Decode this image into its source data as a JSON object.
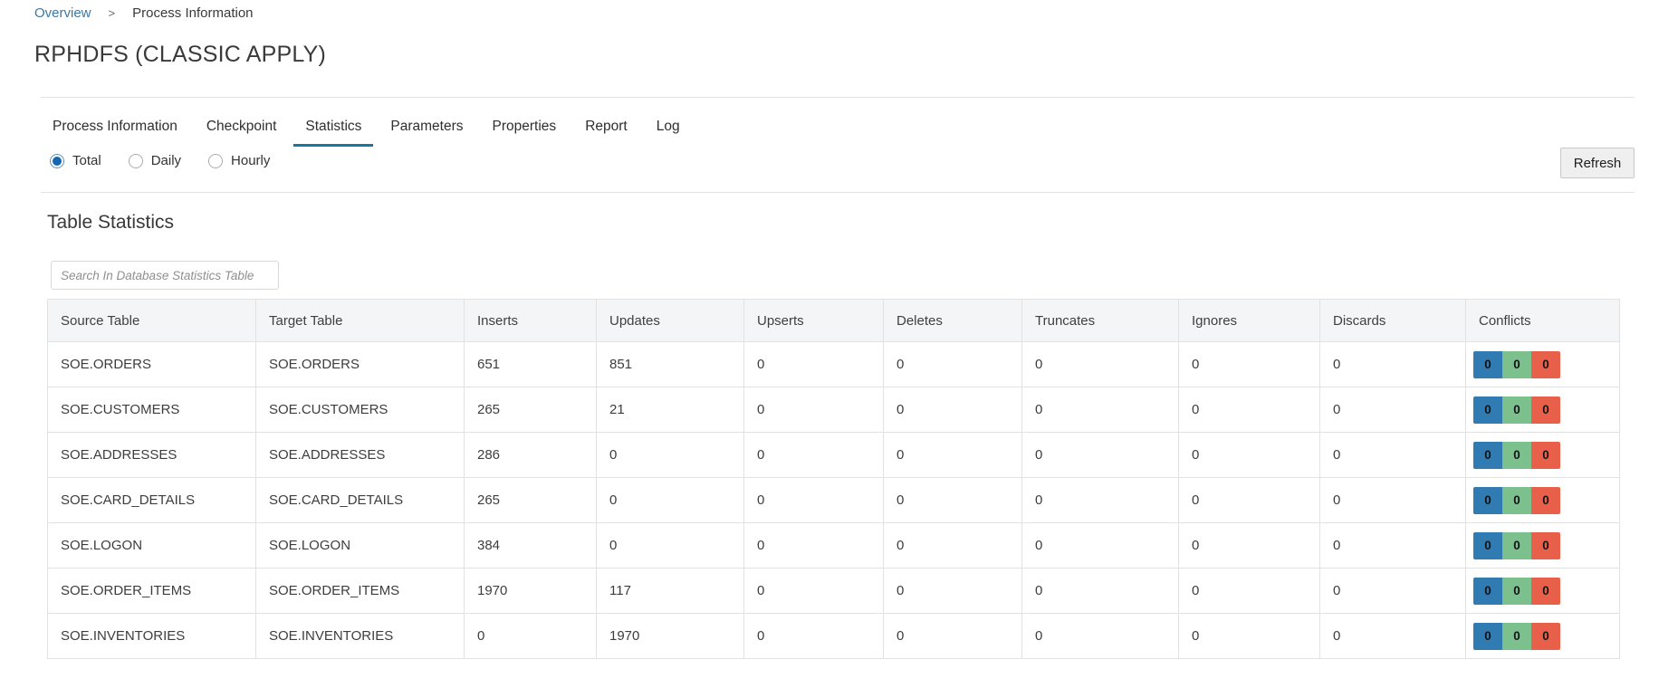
{
  "breadcrumb": {
    "overview": "Overview",
    "separator": ">",
    "current": "Process Information"
  },
  "header": {
    "title": "RPHDFS (CLASSIC APPLY)"
  },
  "tabs": {
    "items": [
      {
        "label": "Process Information",
        "active": false
      },
      {
        "label": "Checkpoint",
        "active": false
      },
      {
        "label": "Statistics",
        "active": true
      },
      {
        "label": "Parameters",
        "active": false
      },
      {
        "label": "Properties",
        "active": false
      },
      {
        "label": "Report",
        "active": false
      },
      {
        "label": "Log",
        "active": false
      }
    ]
  },
  "filters": {
    "options": [
      {
        "label": "Total",
        "selected": true
      },
      {
        "label": "Daily",
        "selected": false
      },
      {
        "label": "Hourly",
        "selected": false
      }
    ]
  },
  "toolbar": {
    "refresh": "Refresh"
  },
  "section": {
    "title": "Table Statistics"
  },
  "search": {
    "placeholder": "Search In Database Statistics Table",
    "value": ""
  },
  "colors": {
    "accent_tab_underline": "#15799f",
    "link_blue": "#3879a8",
    "radio_blue": "#1467b3"
  },
  "table": {
    "columns": [
      "Source Table",
      "Target Table",
      "Inserts",
      "Updates",
      "Upserts",
      "Deletes",
      "Truncates",
      "Ignores",
      "Discards",
      "Conflicts"
    ],
    "conflict_colors": [
      "#2f7bb2",
      "#7cc08e",
      "#e8604a"
    ],
    "rows": [
      {
        "source": "SOE.ORDERS",
        "target": "SOE.ORDERS",
        "inserts": "651",
        "updates": "851",
        "upserts": "0",
        "deletes": "0",
        "truncates": "0",
        "ignores": "0",
        "discards": "0",
        "conflicts": [
          "0",
          "0",
          "0"
        ]
      },
      {
        "source": "SOE.CUSTOMERS",
        "target": "SOE.CUSTOMERS",
        "inserts": "265",
        "updates": "21",
        "upserts": "0",
        "deletes": "0",
        "truncates": "0",
        "ignores": "0",
        "discards": "0",
        "conflicts": [
          "0",
          "0",
          "0"
        ]
      },
      {
        "source": "SOE.ADDRESSES",
        "target": "SOE.ADDRESSES",
        "inserts": "286",
        "updates": "0",
        "upserts": "0",
        "deletes": "0",
        "truncates": "0",
        "ignores": "0",
        "discards": "0",
        "conflicts": [
          "0",
          "0",
          "0"
        ]
      },
      {
        "source": "SOE.CARD_DETAILS",
        "target": "SOE.CARD_DETAILS",
        "inserts": "265",
        "updates": "0",
        "upserts": "0",
        "deletes": "0",
        "truncates": "0",
        "ignores": "0",
        "discards": "0",
        "conflicts": [
          "0",
          "0",
          "0"
        ]
      },
      {
        "source": "SOE.LOGON",
        "target": "SOE.LOGON",
        "inserts": "384",
        "updates": "0",
        "upserts": "0",
        "deletes": "0",
        "truncates": "0",
        "ignores": "0",
        "discards": "0",
        "conflicts": [
          "0",
          "0",
          "0"
        ]
      },
      {
        "source": "SOE.ORDER_ITEMS",
        "target": "SOE.ORDER_ITEMS",
        "inserts": "1970",
        "updates": "117",
        "upserts": "0",
        "deletes": "0",
        "truncates": "0",
        "ignores": "0",
        "discards": "0",
        "conflicts": [
          "0",
          "0",
          "0"
        ]
      },
      {
        "source": "SOE.INVENTORIES",
        "target": "SOE.INVENTORIES",
        "inserts": "0",
        "updates": "1970",
        "upserts": "0",
        "deletes": "0",
        "truncates": "0",
        "ignores": "0",
        "discards": "0",
        "conflicts": [
          "0",
          "0",
          "0"
        ]
      }
    ]
  }
}
